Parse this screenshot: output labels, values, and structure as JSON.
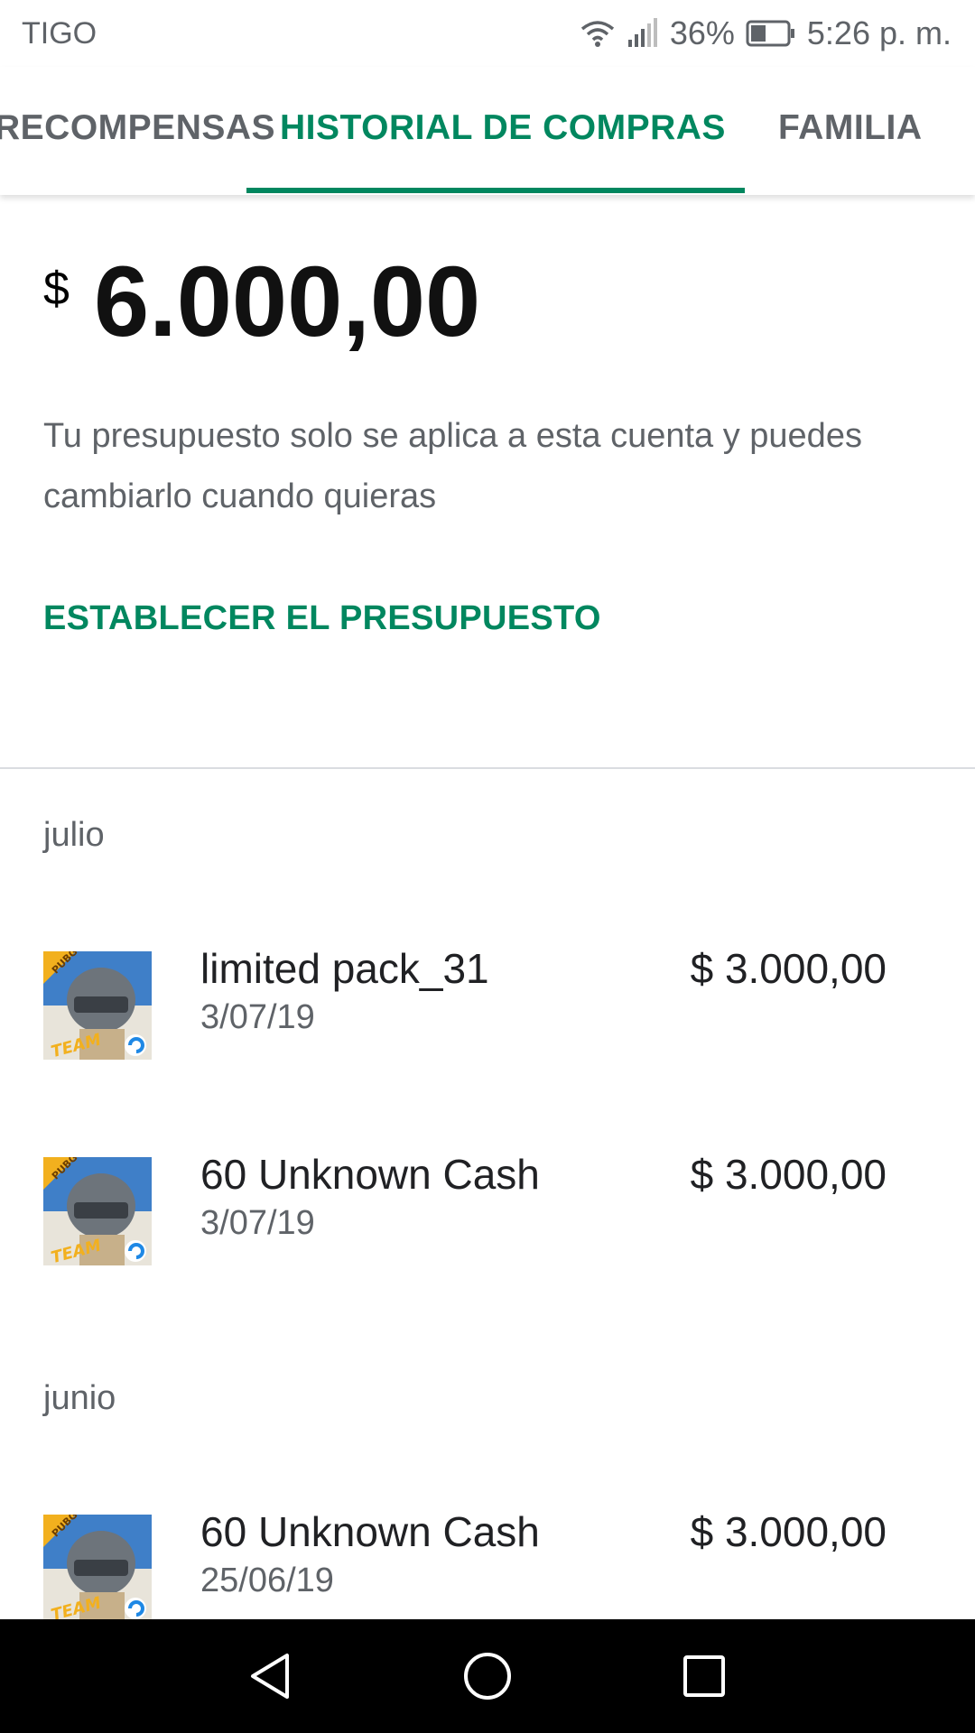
{
  "status_bar": {
    "carrier": "TIGO",
    "battery": "36%",
    "time": "5:26 p. m."
  },
  "tabs": [
    {
      "label": "RECOMPENSAS",
      "active": false
    },
    {
      "label": "HISTORIAL DE COMPRAS",
      "active": true
    },
    {
      "label": "FAMILIA",
      "active": false
    }
  ],
  "budget": {
    "currency": "$",
    "amount": "6.000,00",
    "description": "Tu presupuesto solo se aplica a esta cuenta y puedes cambiarlo cuando quieras",
    "set_button": "ESTABLECER EL PRESUPUESTO"
  },
  "months": [
    {
      "label": "julio",
      "purchases": [
        {
          "name": "limited pack_31",
          "date": "3/07/19",
          "price": "$ 3.000,00",
          "icon": "pubg-app-icon"
        },
        {
          "name": "60 Unknown Cash",
          "date": "3/07/19",
          "price": "$ 3.000,00",
          "icon": "pubg-app-icon"
        }
      ]
    },
    {
      "label": "junio",
      "purchases": [
        {
          "name": "60 Unknown Cash",
          "date": "25/06/19",
          "price": "$ 3.000,00",
          "icon": "pubg-app-icon"
        }
      ]
    }
  ],
  "colors": {
    "accent": "#01875f",
    "text_secondary": "#5f6368",
    "nav_bar": "#000000"
  },
  "nav": {
    "back": "back-icon",
    "home": "home-icon",
    "recents": "recents-icon"
  }
}
